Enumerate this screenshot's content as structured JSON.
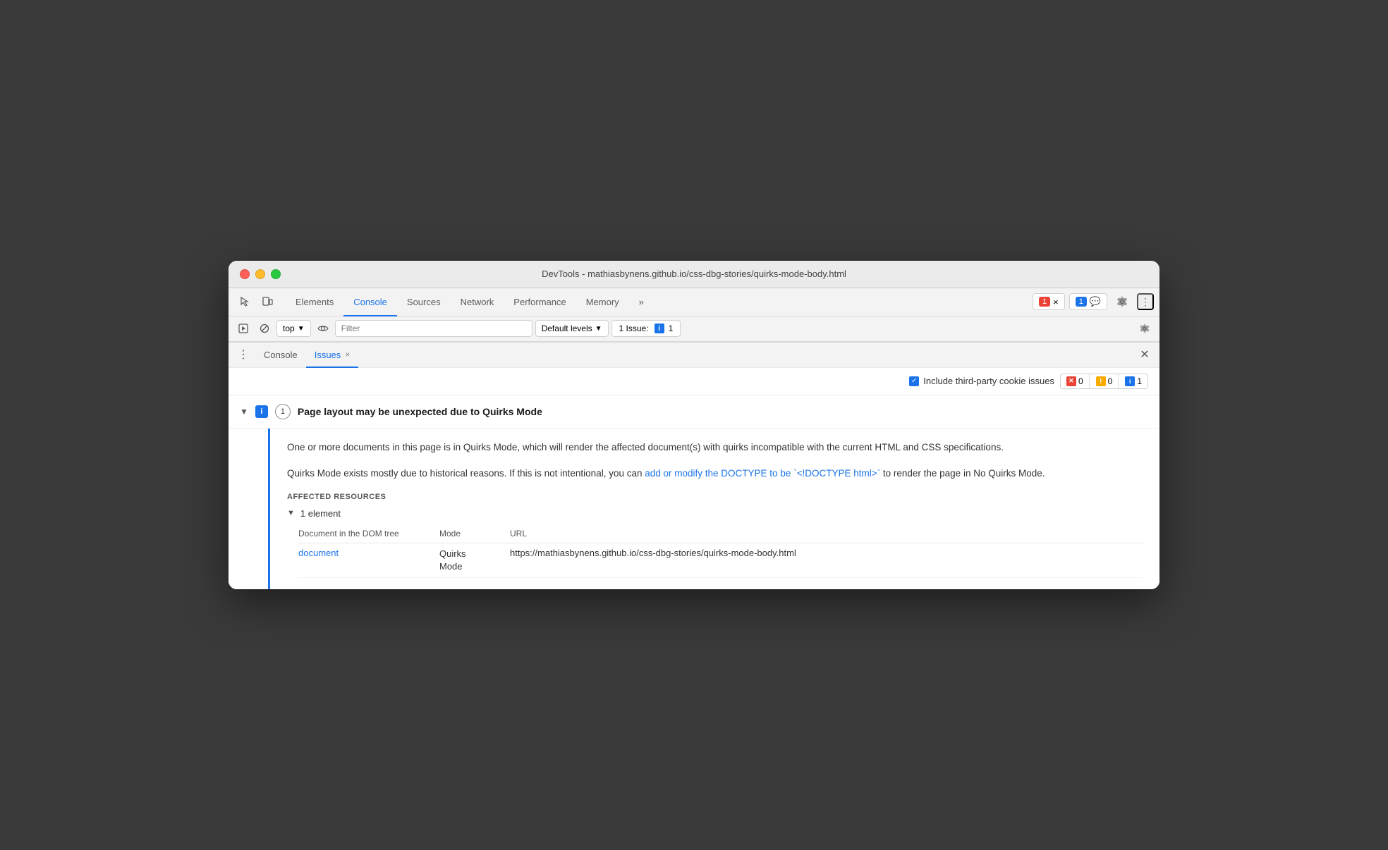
{
  "window": {
    "title": "DevTools - mathiasbynens.github.io/css-dbg-stories/quirks-mode-body.html"
  },
  "traffic_lights": {
    "red": "close",
    "yellow": "minimize",
    "green": "maximize"
  },
  "tabs": {
    "items": [
      {
        "label": "Elements",
        "active": false
      },
      {
        "label": "Console",
        "active": true
      },
      {
        "label": "Sources",
        "active": false
      },
      {
        "label": "Network",
        "active": false
      },
      {
        "label": "Performance",
        "active": false
      },
      {
        "label": "Memory",
        "active": false
      },
      {
        "label": "»",
        "active": false
      }
    ]
  },
  "toolbar_right": {
    "error_count": "1",
    "message_count": "1",
    "settings_icon": "gear-icon",
    "more_icon": "more-icon"
  },
  "console_toolbar": {
    "run_icon": "run-icon",
    "block_icon": "block-icon",
    "context_label": "top",
    "eye_icon": "eye-icon",
    "filter_placeholder": "Filter",
    "default_levels": "Default levels",
    "issues_label": "1 Issue:",
    "issues_count": "1",
    "settings_icon": "settings-icon"
  },
  "drawer": {
    "tabs": [
      {
        "label": "Console",
        "active": false,
        "closeable": false
      },
      {
        "label": "Issues",
        "active": true,
        "closeable": true
      }
    ],
    "close_label": "×"
  },
  "issues_toolbar": {
    "checkbox_checked": true,
    "include_label": "Include third-party cookie issues",
    "counts": [
      {
        "type": "error",
        "count": "0",
        "icon": "×"
      },
      {
        "type": "warning",
        "count": "0",
        "icon": "!"
      },
      {
        "type": "info",
        "count": "1",
        "icon": "i"
      }
    ]
  },
  "issue": {
    "arrow_expanded": true,
    "icon": "i",
    "count": "1",
    "title": "Page layout may be unexpected due to Quirks Mode",
    "description_1": "One or more documents in this page is in Quirks Mode, which will render the affected document(s) with quirks incompatible with the current HTML and CSS specifications.",
    "description_2_before": "Quirks Mode exists mostly due to historical reasons. If this is not intentional, you can ",
    "description_2_link": "add or modify the DOCTYPE to be `<!DOCTYPE html>`",
    "description_2_after": " to render the page in No Quirks Mode.",
    "affected_label": "AFFECTED RESOURCES",
    "element_count": "1 element",
    "col_doc": "Document in the DOM tree",
    "col_mode": "Mode",
    "col_url": "URL",
    "resource_link": "document",
    "resource_mode_line1": "Quirks",
    "resource_mode_line2": "Mode",
    "resource_url": "https://mathiasbynens.github.io/css-dbg-stories/quirks-mode-body.html"
  }
}
